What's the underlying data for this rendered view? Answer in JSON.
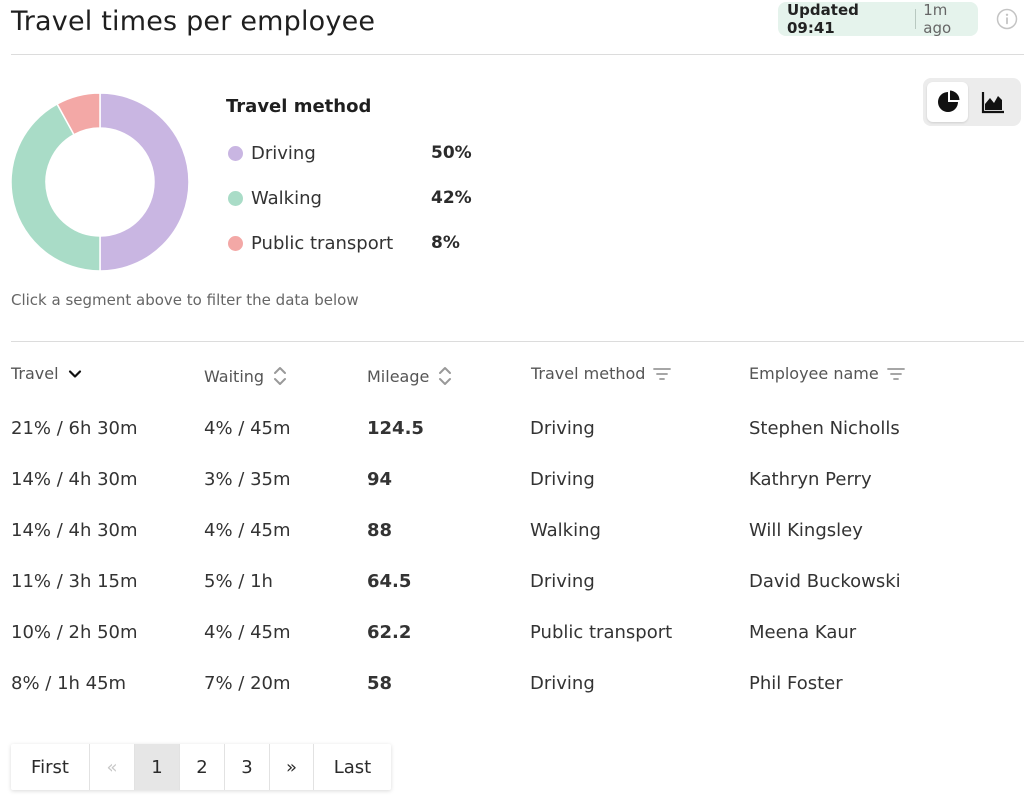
{
  "header": {
    "title": "Travel times per employee",
    "updated_label": "Updated 09:41",
    "updated_ago": "1m ago"
  },
  "chart_data": {
    "type": "pie",
    "title": "Travel method",
    "categories": [
      "Driving",
      "Walking",
      "Public transport"
    ],
    "values": [
      50,
      42,
      8
    ],
    "value_labels": [
      "50%",
      "42%",
      "8%"
    ],
    "colors": [
      "#c9b6e2",
      "#a9dcc7",
      "#f3a8a6"
    ]
  },
  "hint": "Click a segment above to filter the data below",
  "table": {
    "columns": [
      "Travel",
      "Waiting",
      "Mileage",
      "Travel method",
      "Employee name"
    ],
    "rows": [
      [
        "21% / 6h 30m",
        "4% / 45m",
        "124.5",
        "Driving",
        "Stephen Nicholls"
      ],
      [
        "14% / 4h 30m",
        "3% / 35m",
        "94",
        "Driving",
        "Kathryn Perry"
      ],
      [
        "14% / 4h 30m",
        "4% / 45m",
        "88",
        "Walking",
        "Will Kingsley"
      ],
      [
        "11% / 3h 15m",
        "5% / 1h",
        "64.5",
        "Driving",
        "David Buckowski"
      ],
      [
        "10% / 2h 50m",
        "4% / 45m",
        "62.2",
        "Public transport",
        "Meena Kaur"
      ],
      [
        "8% / 1h 45m",
        "7% / 20m",
        "58",
        "Driving",
        "Phil Foster"
      ]
    ]
  },
  "pagination": {
    "first": "First",
    "prev": "«",
    "pages": [
      "1",
      "2",
      "3"
    ],
    "next": "»",
    "last": "Last",
    "current": "1"
  }
}
